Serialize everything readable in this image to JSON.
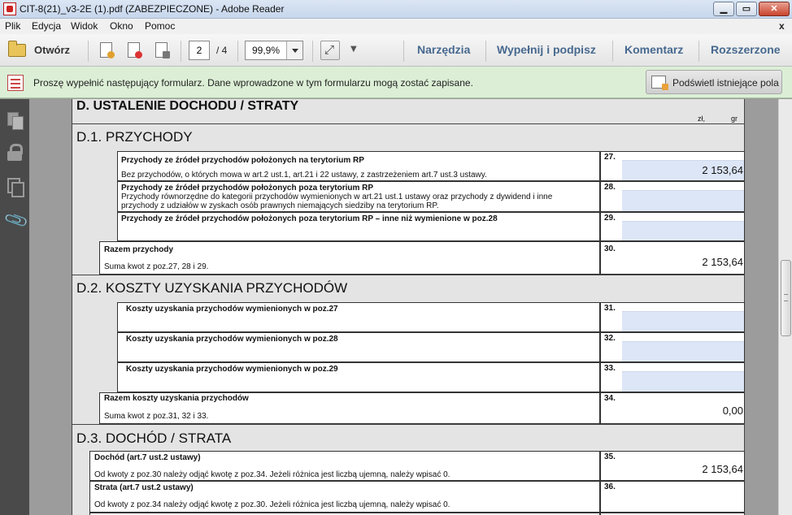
{
  "window": {
    "title": "CIT-8(21)_v3-2E (1).pdf (ZABEZPIECZONE) - Adobe Reader",
    "minimize_glyph": "▁",
    "maximize_glyph": "▭",
    "close_glyph": "✕"
  },
  "menu": {
    "items": [
      "Plik",
      "Edycja",
      "Widok",
      "Okno",
      "Pomoc"
    ],
    "close_glyph": "x"
  },
  "toolbar": {
    "open_label": "Otwórz",
    "page_current": "2",
    "page_total": "/ 4",
    "zoom": "99,9%",
    "more_glyph": "▼",
    "right_links": [
      "Narzędzia",
      "Wypełnij i podpisz",
      "Komentarz",
      "Rozszerzone"
    ]
  },
  "notification": {
    "text": "Proszę wypełnić następujący formularz. Dane wprowadzone w tym formularzu mogą zostać zapisane.",
    "button_label": "Podświetl istniejące pola"
  },
  "form": {
    "section_d_title": "D. USTALENIE DOCHODU / STRATY",
    "unit_zl": "zł,",
    "unit_gr": "gr",
    "d1": {
      "title": "D.1. PRZYCHODY",
      "rows": [
        {
          "num": "27.",
          "label": "Przychody ze źródeł przychodów położonych na terytorium RP",
          "sub": "Bez przychodów, o których mowa w art.2 ust.1, art.21 i 22 ustawy, z zastrzeżeniem art.7 ust.3 ustawy.",
          "value": "2 153,64"
        },
        {
          "num": "28.",
          "label": "Przychody ze źródeł przychodów położonych poza terytorium RP",
          "sub1": "Przychody równorzędne do kategorii przychodów wymienionych w art.21 ust.1 ustawy oraz przychody z dywidend i inne",
          "sub2": "przychody z udziałów w zyskach osób prawnych niemających siedziby na terytorium RP.",
          "value": ""
        },
        {
          "num": "29.",
          "label": "Przychody ze źródeł przychodów położonych poza terytorium RP – inne niż wymienione w poz.28",
          "value": ""
        }
      ],
      "total": {
        "num": "30.",
        "label": "Razem przychody",
        "sub": "Suma kwot z poz.27, 28 i 29.",
        "value": "2 153,64"
      }
    },
    "d2": {
      "title": "D.2. KOSZTY UZYSKANIA PRZYCHODÓW",
      "rows": [
        {
          "num": "31.",
          "label": "Koszty uzyskania przychodów wymienionych w poz.27",
          "value": ""
        },
        {
          "num": "32.",
          "label": "Koszty uzyskania przychodów wymienionych w poz.28",
          "value": ""
        },
        {
          "num": "33.",
          "label": "Koszty uzyskania przychodów wymienionych w poz.29",
          "value": ""
        }
      ],
      "total": {
        "num": "34.",
        "label": "Razem koszty uzyskania przychodów",
        "sub": "Suma kwot z poz.31, 32 i 33.",
        "value": "0,00"
      }
    },
    "d3": {
      "title": "D.3. DOCHÓD / STRATA",
      "rows": [
        {
          "num": "35.",
          "label": "Dochód (art.7 ust.2 ustawy)",
          "sub": "Od kwoty z poz.30 należy odjąć kwotę z poz.34. Jeżeli różnica jest liczbą ujemną, należy wpisać 0.",
          "value": "2 153,64"
        },
        {
          "num": "36.",
          "label": "Strata (art.7 ust.2 ustawy)",
          "sub": "Od kwoty z poz.34 należy odjąć kwotę z poz.30. Jeżeli różnica jest liczbą ujemną, należy wpisać 0.",
          "value": ""
        }
      ]
    }
  }
}
